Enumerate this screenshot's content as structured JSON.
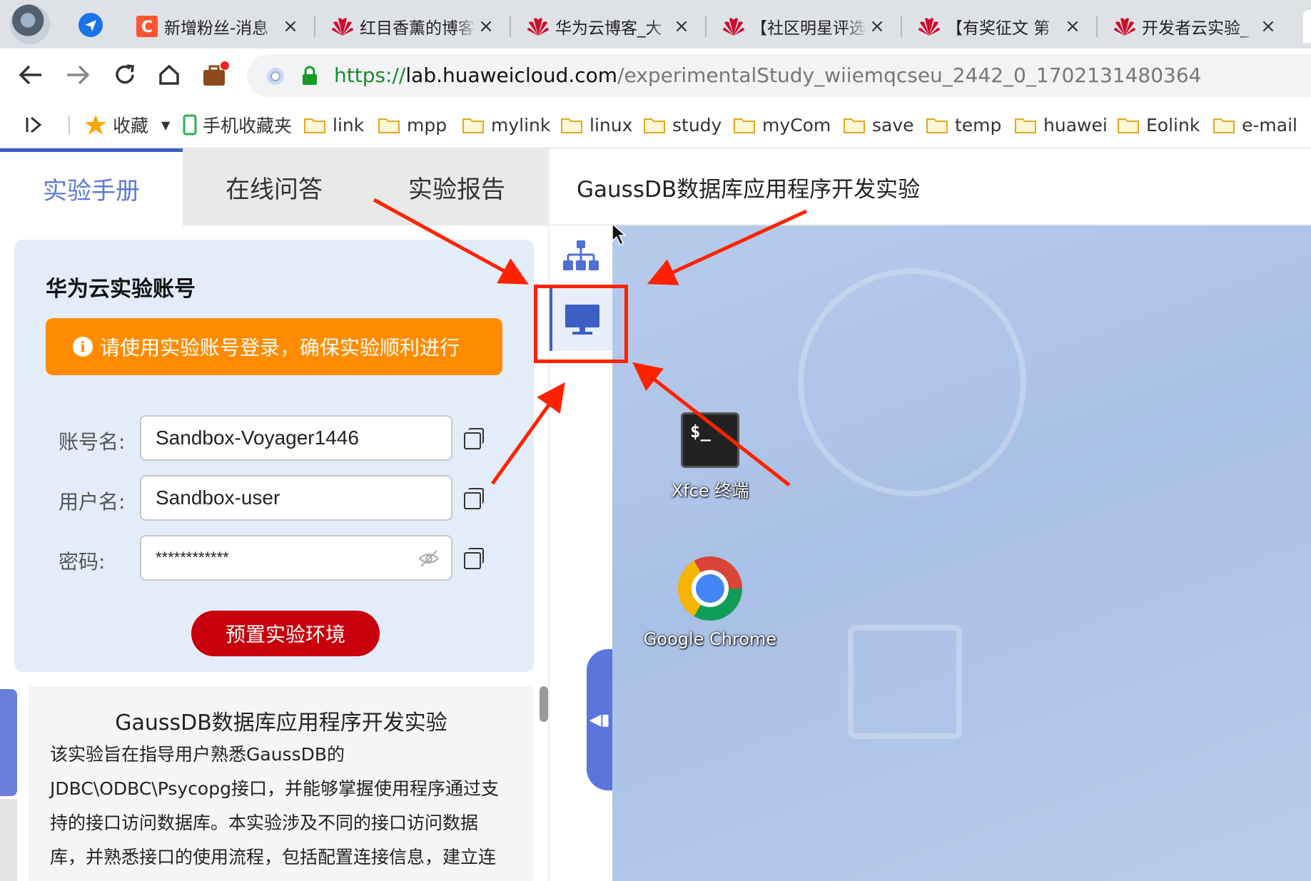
{
  "browser": {
    "tabs": [
      {
        "title": "新增粉丝-消息",
        "favicon": "csdn-icon"
      },
      {
        "title": "红目香薰的博客",
        "favicon": "huawei-logo-icon"
      },
      {
        "title": "华为云博客_大",
        "favicon": "huawei-logo-icon"
      },
      {
        "title": "【社区明星评选",
        "favicon": "huawei-logo-icon"
      },
      {
        "title": "【有奖征文 第",
        "favicon": "huawei-logo-icon"
      },
      {
        "title": "开发者云实验_",
        "favicon": "huawei-logo-icon"
      }
    ],
    "url": {
      "scheme": "https://",
      "host": "lab.huaweicloud.com",
      "path": "/experimentalStudy_wiiemqcseu_2442_0_1702131480364"
    },
    "bookmarks": [
      {
        "label": "收藏",
        "icon": "star-icon"
      },
      {
        "label": "手机收藏夹",
        "icon": "phone-icon"
      },
      {
        "label": "link",
        "icon": "folder-icon"
      },
      {
        "label": "mpp",
        "icon": "folder-icon"
      },
      {
        "label": "mylink",
        "icon": "folder-icon"
      },
      {
        "label": "linux",
        "icon": "folder-icon"
      },
      {
        "label": "study",
        "icon": "folder-icon"
      },
      {
        "label": "myCom",
        "icon": "folder-icon"
      },
      {
        "label": "save",
        "icon": "folder-icon"
      },
      {
        "label": "temp",
        "icon": "folder-icon"
      },
      {
        "label": "huawei",
        "icon": "folder-icon"
      },
      {
        "label": "Eolink",
        "icon": "folder-icon"
      },
      {
        "label": "e-mail",
        "icon": "folder-icon"
      }
    ]
  },
  "lab": {
    "tabs": [
      "实验手册",
      "在线问答",
      "实验报告"
    ],
    "account": {
      "title": "华为云实验账号",
      "notice": "请使用实验账号登录，确保实验顺利进行",
      "fields": [
        {
          "label": "账号名:",
          "value": "Sandbox-Voyager1446"
        },
        {
          "label": "用户名:",
          "value": "Sandbox-user"
        },
        {
          "label": "密码:",
          "value": "************"
        }
      ],
      "button": "预置实验环境"
    },
    "guide": {
      "title": "GaussDB数据库应用程序开发实验",
      "lines": [
        "该实验旨在指导用户熟悉GaussDB的",
        "JDBC\\ODBC\\Psycopg接口，并能够掌握使用程序通过支",
        "持的接口访问数据库。本实验涉及不同的接口访问数据",
        "库，并熟悉接口的使用流程，包括配置连接信息，建立连"
      ]
    }
  },
  "experiment": {
    "title": "GaussDB数据库应用程序开发实验",
    "desktop_icons": [
      {
        "label": "Xfce 终端",
        "icon": "terminal-icon",
        "glyph": "$_"
      },
      {
        "label": "Google Chrome",
        "icon": "chrome-icon"
      }
    ]
  },
  "colors": {
    "accent": "#3d5fc4",
    "notice": "#ff8c00",
    "primary_button": "#c7000b",
    "annotation": "#ff2200"
  }
}
